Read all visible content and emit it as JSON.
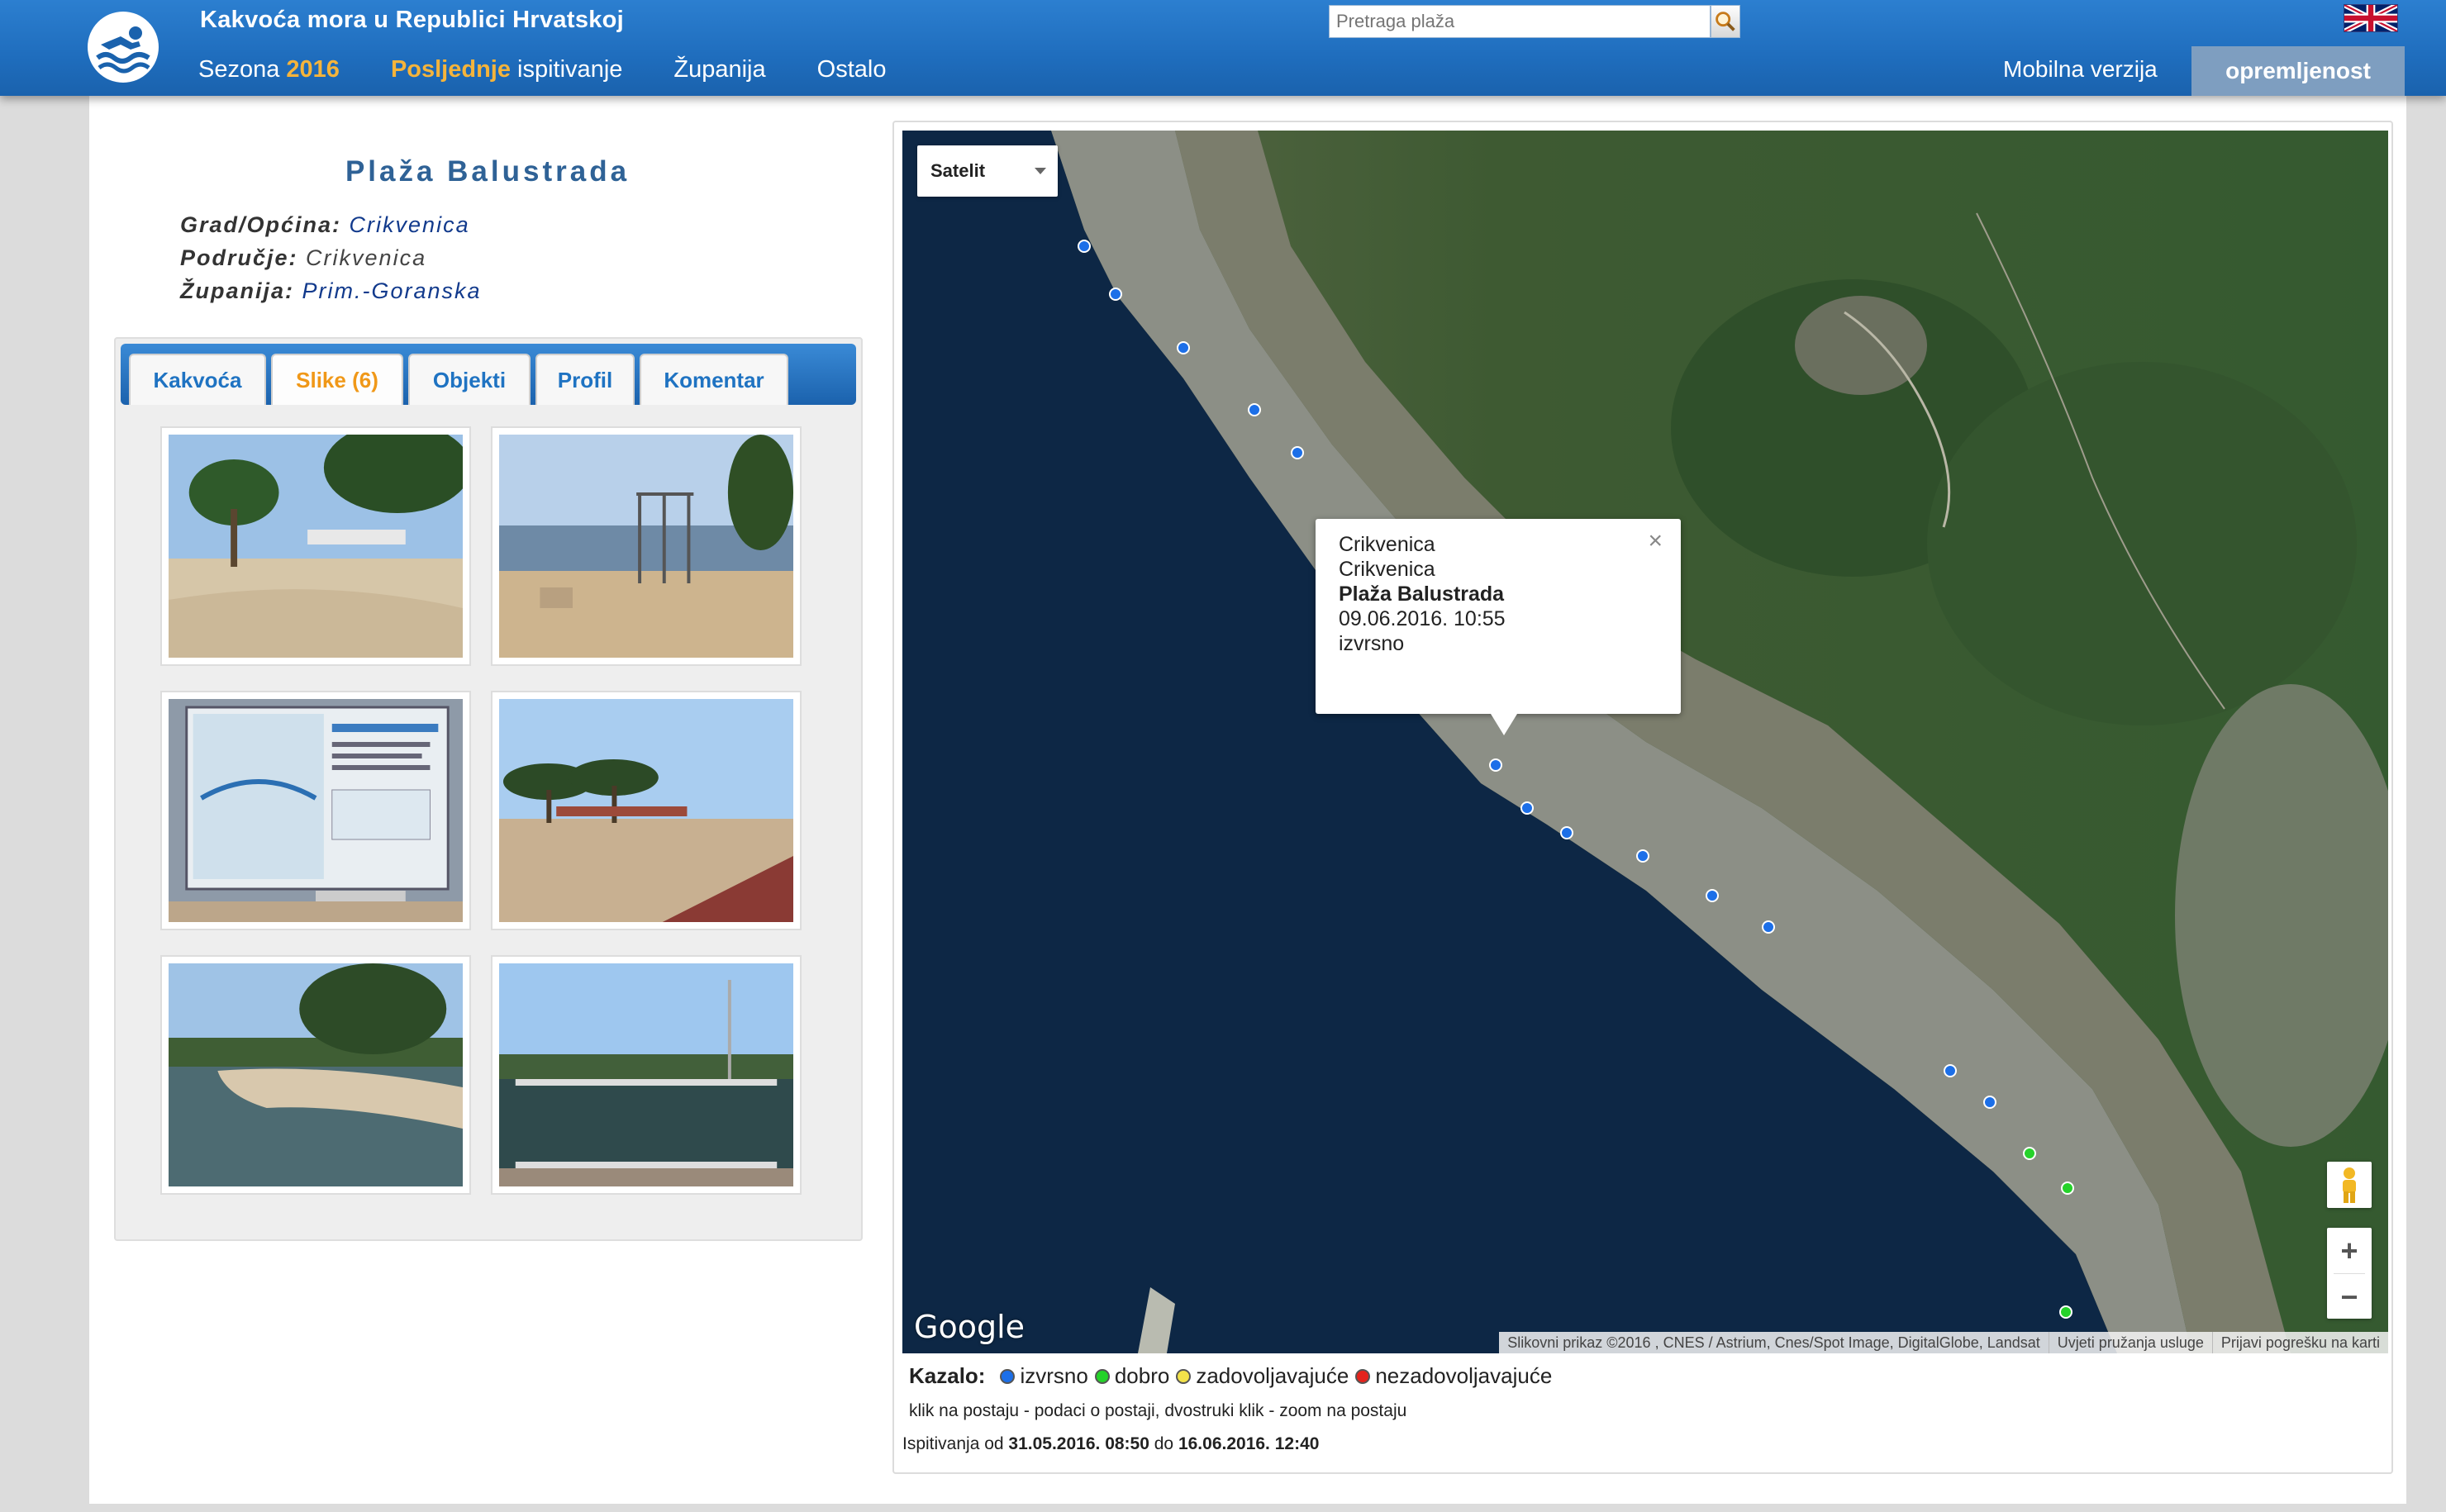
{
  "header": {
    "site_title": "Kakvoća mora u Republici Hrvatskoj",
    "nav": {
      "season_label": "Sezona",
      "season_year": "2016",
      "last_prefix": "Posljednje",
      "last_suffix": "ispitivanje",
      "county": "Županija",
      "other": "Ostalo"
    },
    "search_placeholder": "Pretraga plaža",
    "mobile": "Mobilna verzija",
    "equipment": "opremljenost"
  },
  "beach": {
    "title": "Plaža Balustrada",
    "city_label": "Grad/Općina:",
    "city_value": "Crikvenica",
    "area_label": "Područje:",
    "area_value": "Crikvenica",
    "county_label": "Županija:",
    "county_value": "Prim.-Goranska"
  },
  "tabs": [
    {
      "label": "Kakvoća"
    },
    {
      "label": "Slike (6)"
    },
    {
      "label": "Objekti"
    },
    {
      "label": "Profil"
    },
    {
      "label": "Komentar"
    }
  ],
  "map": {
    "type_select": "Satelit",
    "popup": {
      "line1": "Crikvenica",
      "line2": "Crikvenica",
      "name": "Plaža Balustrada",
      "datetime": "09.06.2016. 10:55",
      "rating": "izvrsno"
    },
    "google": "Google",
    "attribution": "Slikovni prikaz ©2016 , CNES / Astrium, Cnes/Spot Image, DigitalGlobe, Landsat",
    "terms": "Uvjeti pružanja usluge",
    "report": "Prijavi pogrešku na karti",
    "colors": {
      "excellent": "#1c6fe8",
      "good": "#25d22a",
      "satisfactory": "#f2e24a",
      "unsatisfactory": "#e3241d"
    }
  },
  "legend": {
    "key": "Kazalo:",
    "excellent": "izvrsno",
    "good": "dobro",
    "satisfactory": "zadovoljavajuće",
    "unsatisfactory": "nezadovoljavajuće",
    "hint": "klik na postaju - podaci o postaji, dvostruki klik - zoom na postaju",
    "range_prefix": "Ispitivanja od",
    "range_from": "31.05.2016. 08:50",
    "range_mid": "do",
    "range_to": "16.06.2016. 12:40"
  }
}
